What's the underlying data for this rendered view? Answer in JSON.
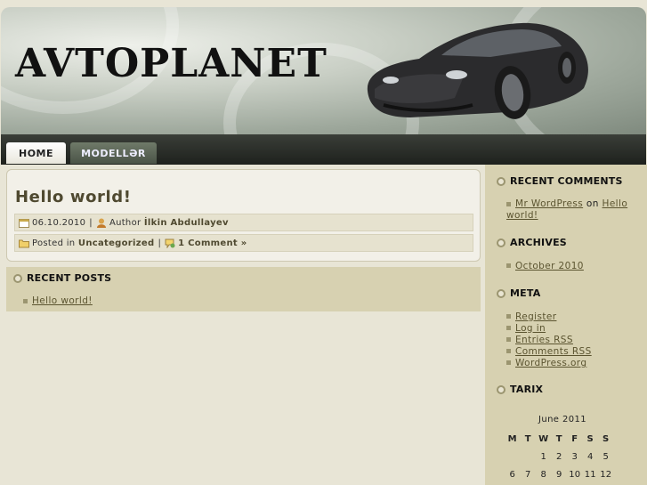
{
  "site": {
    "title": "AVTOPLANET"
  },
  "nav": {
    "home": "HOME",
    "models": "MODELLƏR"
  },
  "post": {
    "title": "Hello world!",
    "date": "06.10.2010",
    "separator": "|",
    "author_prefix": "Author",
    "author": "İlkin Abdullayev",
    "posted_in": "Posted in",
    "category": "Uncategorized",
    "comments": "1 Comment »"
  },
  "recent_posts": {
    "title": "RECENT POSTS",
    "items": [
      "Hello world!"
    ]
  },
  "sidebar": {
    "recent_comments": {
      "title": "RECENT COMMENTS",
      "author": "Mr WordPress",
      "on": "on",
      "post": "Hello world!"
    },
    "archives": {
      "title": "ARCHIVES",
      "items": [
        "October 2010"
      ]
    },
    "meta": {
      "title": "META",
      "items": [
        "Register",
        "Log in",
        "Entries RSS",
        "Comments RSS",
        "WordPress.org"
      ]
    },
    "tarix": {
      "title": "TARIX",
      "caption": "June 2011",
      "days": [
        "M",
        "T",
        "W",
        "T",
        "F",
        "S",
        "S"
      ],
      "rows": [
        [
          "",
          "",
          "1",
          "2",
          "3",
          "4",
          "5"
        ],
        [
          "6",
          "7",
          "8",
          "9",
          "10",
          "11",
          "12"
        ]
      ]
    }
  },
  "icons": [
    "calendar-icon",
    "author-icon",
    "folder-icon",
    "comment-icon",
    "car-image"
  ],
  "colors": {
    "accent": "#4f4930",
    "sidebar_bg": "#d7d1b1",
    "nav_bg": "#2b2f29"
  }
}
